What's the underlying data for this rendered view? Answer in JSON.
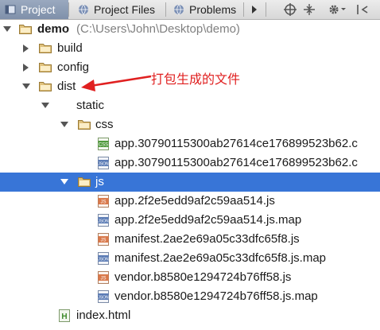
{
  "tabs": [
    {
      "label": "Project"
    },
    {
      "label": "Project Files"
    },
    {
      "label": "Problems"
    }
  ],
  "tree": {
    "root": {
      "name": "demo",
      "path": "(C:\\Users\\John\\Desktop\\demo)"
    },
    "build": "build",
    "config": "config",
    "dist": "dist",
    "static": "static",
    "css": "css",
    "css_files": [
      {
        "name": "app.30790115300ab27614ce176899523b62.c",
        "badge": "CSS"
      },
      {
        "name": "app.30790115300ab27614ce176899523b62.c",
        "badge": "JSON"
      }
    ],
    "js": "js",
    "js_files": [
      {
        "name": "app.2f2e5edd9af2c59aa514.js",
        "badge": "JS"
      },
      {
        "name": "app.2f2e5edd9af2c59aa514.js.map",
        "badge": "JSON"
      },
      {
        "name": "manifest.2ae2e69a05c33dfc65f8.js",
        "badge": "JS"
      },
      {
        "name": "manifest.2ae2e69a05c33dfc65f8.js.map",
        "badge": "JSON"
      },
      {
        "name": "vendor.b8580e1294724b76ff58.js",
        "badge": "JS"
      },
      {
        "name": "vendor.b8580e1294724b76ff58.js.map",
        "badge": "JSON"
      }
    ],
    "index": {
      "name": "index.html",
      "badge": "H"
    }
  },
  "annotation": "打包生成的文件",
  "colors": {
    "selection": "#3875d7",
    "folder": "#d9b36c",
    "annotation": "#e02020"
  }
}
